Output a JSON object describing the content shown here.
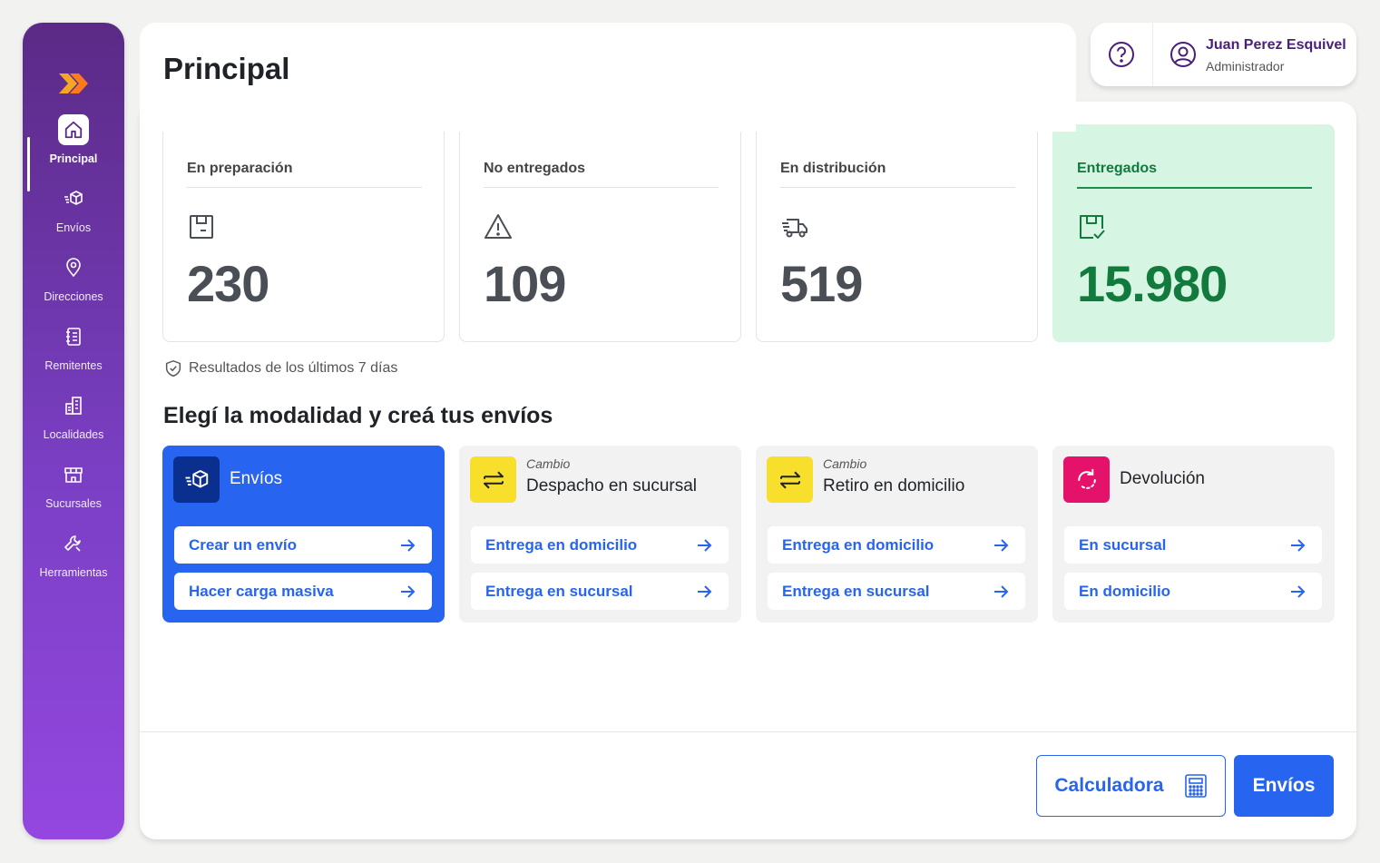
{
  "sidebar": {
    "items": [
      {
        "label": "Principal",
        "icon": "home-icon",
        "active": true
      },
      {
        "label": "Envíos",
        "icon": "package-icon"
      },
      {
        "label": "Direcciones",
        "icon": "location-pin-icon"
      },
      {
        "label": "Remitentes",
        "icon": "notebook-icon"
      },
      {
        "label": "Localidades",
        "icon": "buildings-icon"
      },
      {
        "label": "Sucursales",
        "icon": "store-icon"
      },
      {
        "label": "Herramientas",
        "icon": "wrench-icon"
      }
    ]
  },
  "header": {
    "title": "Principal"
  },
  "user": {
    "name": "Juan Perez Esquivel",
    "role": "Administrador"
  },
  "stats": [
    {
      "title": "En preparación",
      "value": "230",
      "icon": "package-box-icon"
    },
    {
      "title": "No entregados",
      "value": "109",
      "icon": "warning-triangle-icon"
    },
    {
      "title": "En distribución",
      "value": "519",
      "icon": "truck-icon"
    },
    {
      "title": "Entregados",
      "value": "15.980",
      "icon": "package-check-icon",
      "highlight_color": "#127a3d"
    }
  ],
  "results_note": "Resultados de los últimos 7 días",
  "section_title": "Elegí la modalidad y creá tus envíos",
  "modes": [
    {
      "kicker": "",
      "title": "Envíos",
      "icon": "package-fast-icon",
      "icon_bg": "#0b2f8f",
      "actions": [
        "Crear un envío",
        "Hacer carga masiva"
      ]
    },
    {
      "kicker": "Cambio",
      "title": "Despacho en sucursal",
      "icon": "swap-arrows-icon",
      "icon_bg": "#f7df2c",
      "actions": [
        "Entrega en domicilio",
        "Entrega en sucursal"
      ]
    },
    {
      "kicker": "Cambio",
      "title": "Retiro en domicilio",
      "icon": "swap-arrows-icon",
      "icon_bg": "#f7df2c",
      "actions": [
        "Entrega en domicilio",
        "Entrega en sucursal"
      ]
    },
    {
      "kicker": "",
      "title": "Devolución",
      "icon": "return-icon",
      "icon_bg": "#e5126b",
      "actions": [
        "En sucursal",
        "En domicilio"
      ]
    }
  ],
  "footer": {
    "calculator_label": "Calculadora",
    "envios_label": "Envíos"
  },
  "colors": {
    "accent": "#2764ef",
    "sidebar_top": "#5b2a86",
    "sidebar_bottom": "#9447e0",
    "success_bg": "#d6f5e3"
  }
}
